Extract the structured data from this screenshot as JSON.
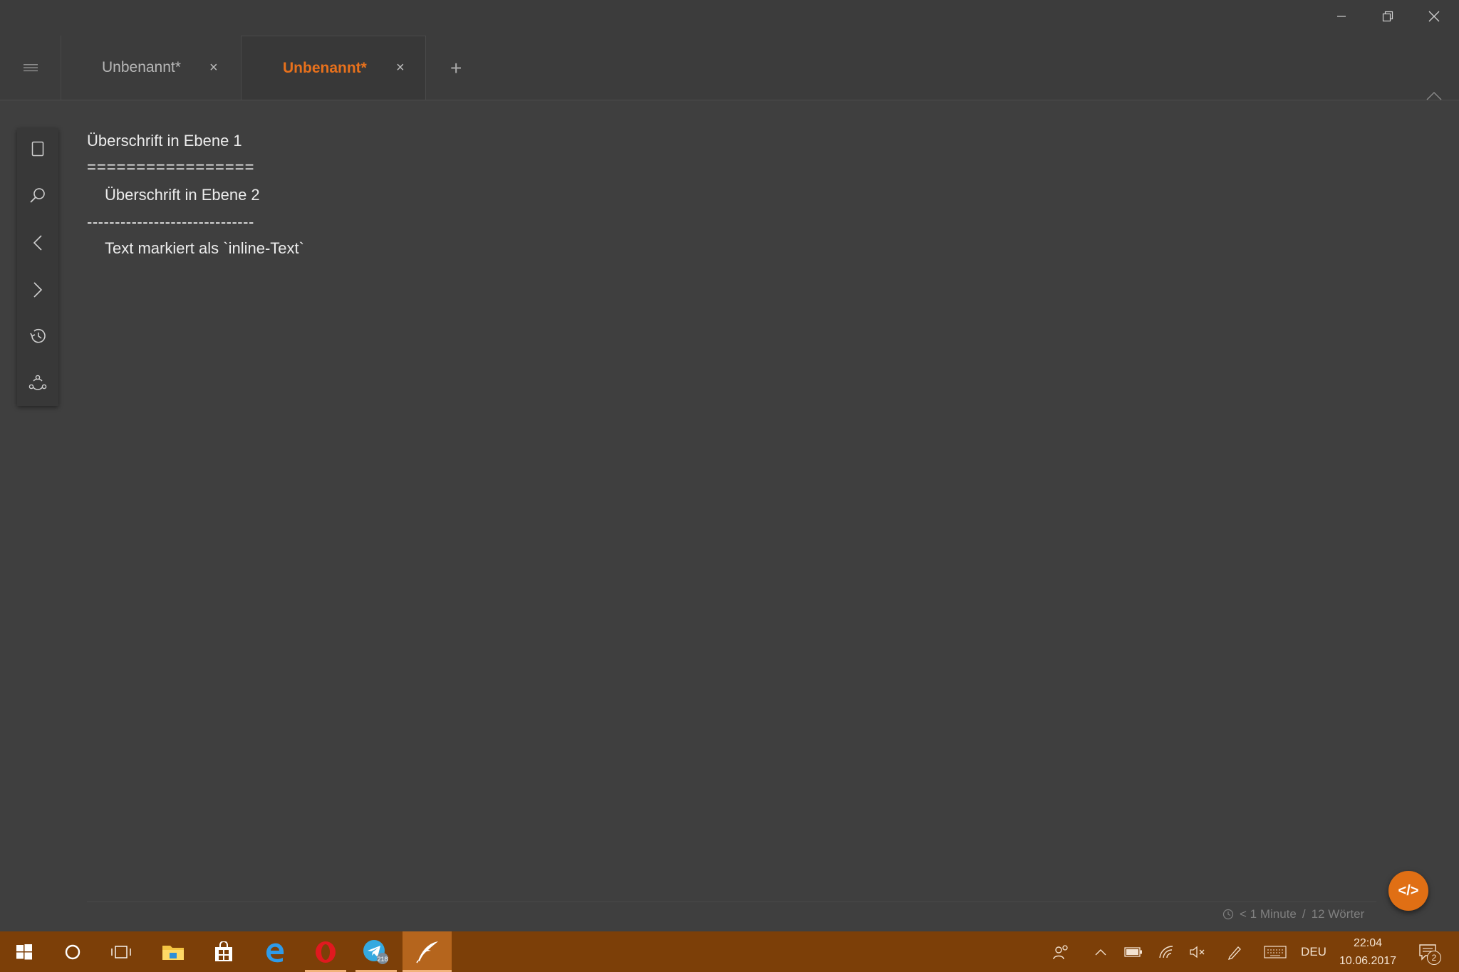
{
  "window": {
    "tabs": [
      {
        "label": "Unbenannt*",
        "close": "×"
      },
      {
        "label": "Unbenannt*",
        "close": "×"
      }
    ],
    "new_tab": "+"
  },
  "sidebar": {
    "items": [
      {
        "icon": "document-icon"
      },
      {
        "icon": "search-icon"
      },
      {
        "icon": "back-icon"
      },
      {
        "icon": "forward-icon"
      },
      {
        "icon": "history-icon"
      },
      {
        "icon": "share-icon"
      }
    ]
  },
  "editor": {
    "lines": [
      "Überschrift in Ebene 1",
      "=================",
      "Überschrift in Ebene 2",
      "------------------------------",
      "Text markiert als `inline-Text`"
    ]
  },
  "status": {
    "reading_time": "< 1 Minute",
    "separator": "/",
    "word_count": "12 Wörter"
  },
  "fab": {
    "label": "</>"
  },
  "taskbar": {
    "apps": [
      {
        "icon": "windows-start-icon"
      },
      {
        "icon": "cortana-icon"
      },
      {
        "icon": "task-view-icon"
      },
      {
        "icon": "file-explorer-icon"
      },
      {
        "icon": "store-icon"
      },
      {
        "icon": "edge-icon"
      },
      {
        "icon": "opera-icon"
      },
      {
        "icon": "telegram-icon",
        "badge": "218"
      },
      {
        "icon": "quill-app-icon"
      }
    ],
    "tray": {
      "language": "DEU",
      "time": "22:04",
      "date": "10.06.2017",
      "notifications": "2"
    }
  },
  "colors": {
    "accent": "#e06f14",
    "background": "#3f3f3f",
    "taskbar": "#7c3f08"
  }
}
